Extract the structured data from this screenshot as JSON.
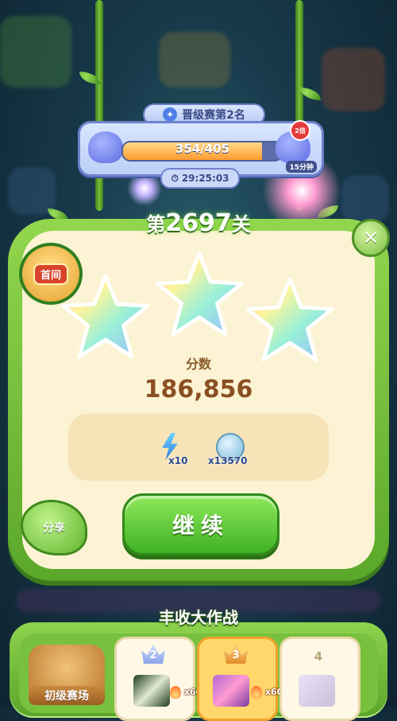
{
  "promotion": {
    "rank_label": "晋级赛第2名",
    "progress_text": "354/405",
    "progress_fraction": 0.874,
    "double_badge": "2倍",
    "time_tag": "15分钟",
    "timer": "29:25:03"
  },
  "level": {
    "prefix": "第",
    "number": "2697",
    "suffix": "关"
  },
  "result": {
    "first_pass_badge": "首间",
    "stars_earned": 3,
    "score_label": "分数",
    "score_value": "186,856",
    "rewards": [
      {
        "icon": "lightning-icon",
        "count": "x10"
      },
      {
        "icon": "coin-icon",
        "count": "x13570"
      }
    ],
    "share_label": "分享",
    "continue_label": "继续"
  },
  "event": {
    "title": "丰收大作战",
    "league_label": "初级赛场",
    "slots": [
      {
        "rank": "2",
        "heat": "x60"
      },
      {
        "rank": "3",
        "heat": "x60"
      },
      {
        "rank": "4"
      }
    ]
  },
  "colors": {
    "panel_green": "#5aa72a",
    "card_cream": "#fbf3d3",
    "progress_orange": "#ff9b2e",
    "continue_green": "#3fb225"
  }
}
